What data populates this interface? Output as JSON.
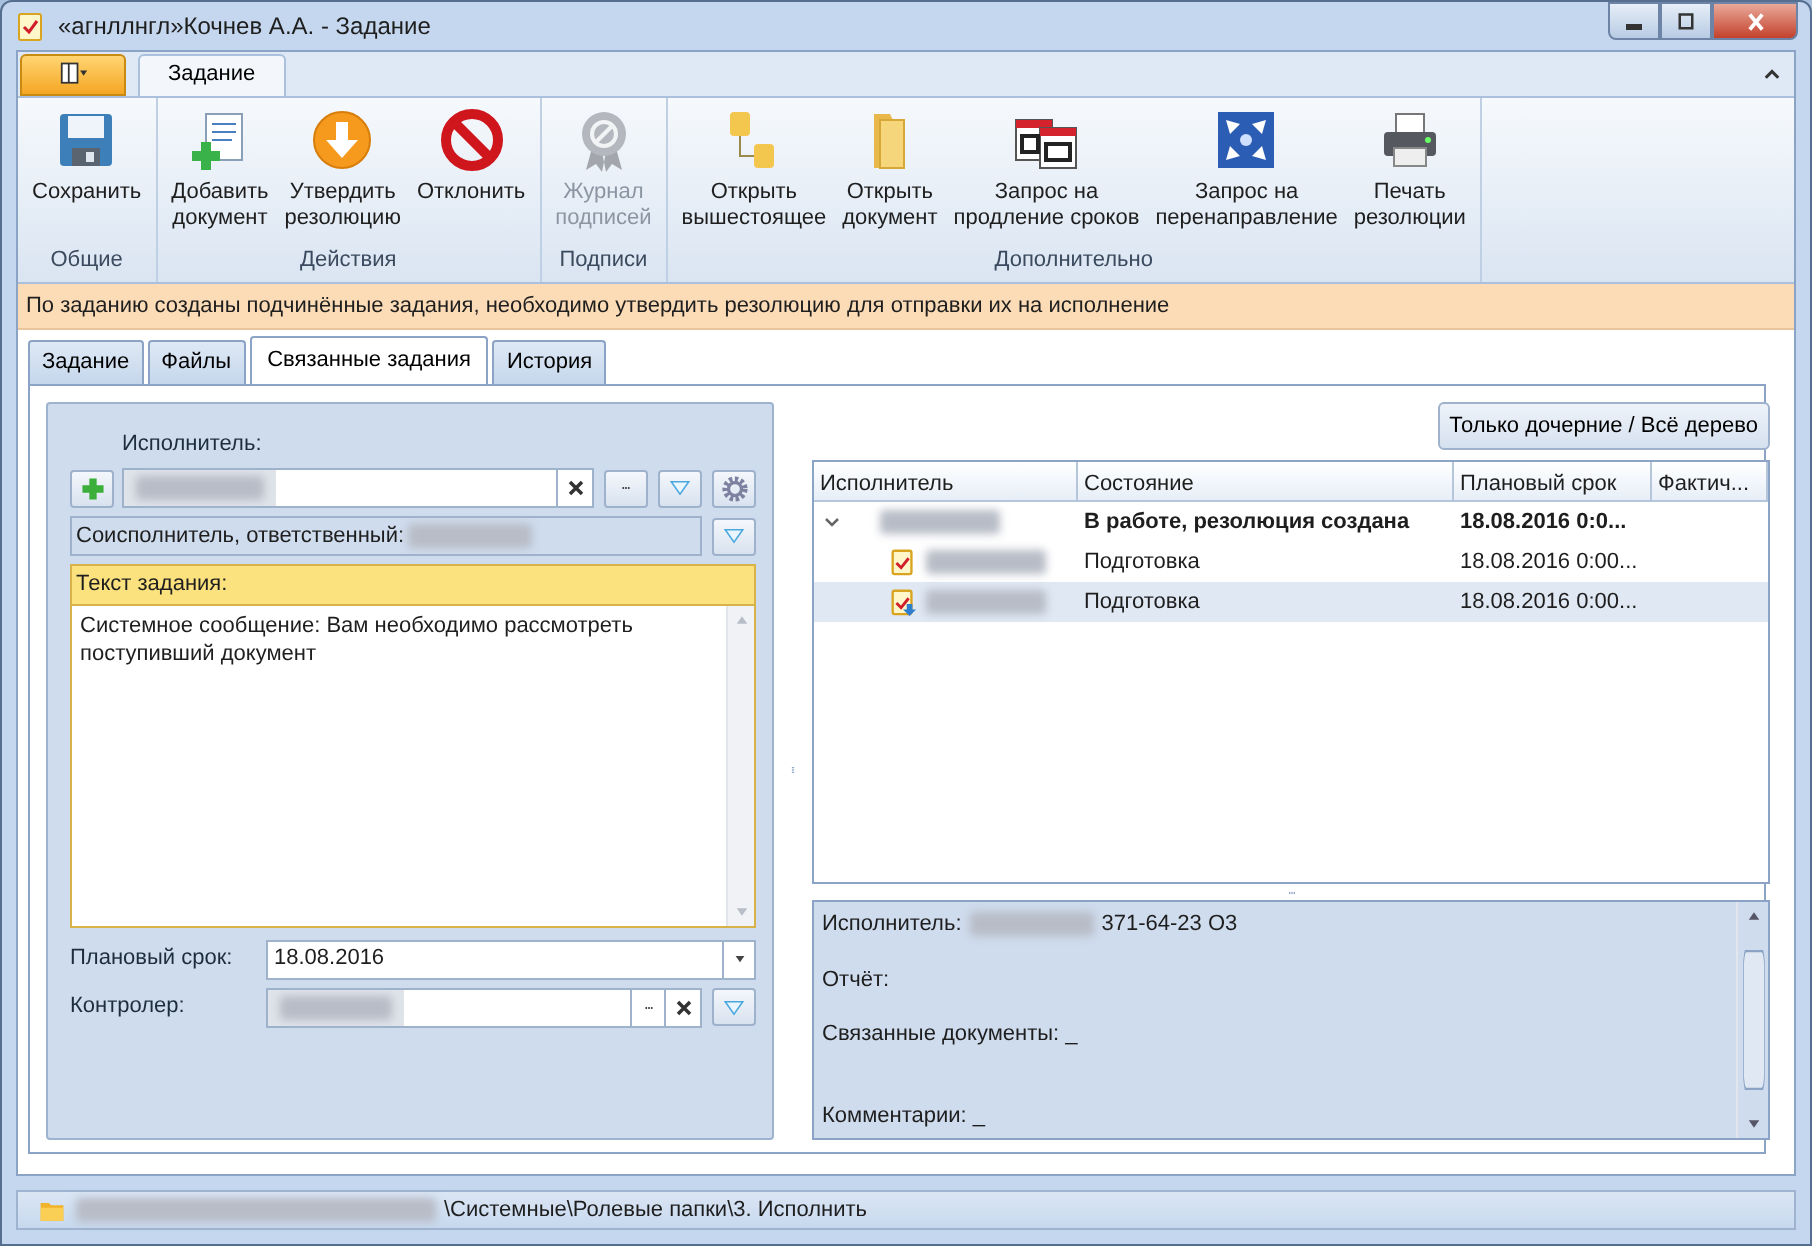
{
  "window": {
    "title": "«агнллнгл»Кочнев А.А. - Задание"
  },
  "ribbon": {
    "tabs": [
      {
        "label": "Задание",
        "selected": true
      }
    ],
    "groups": [
      {
        "label": "Общие",
        "buttons": [
          {
            "label": "Сохранить",
            "disabled": false
          }
        ]
      },
      {
        "label": "Действия",
        "buttons": [
          {
            "label": "Добавить документ",
            "disabled": false
          },
          {
            "label": "Утвердить резолюцию",
            "disabled": false
          },
          {
            "label": "Отклонить",
            "disabled": false
          }
        ]
      },
      {
        "label": "Подписи",
        "buttons": [
          {
            "label": "Журнал подписей",
            "disabled": true
          }
        ]
      },
      {
        "label": "Дополнительно",
        "buttons": [
          {
            "label": "Открыть вышестоящее",
            "disabled": false
          },
          {
            "label": "Открыть документ",
            "disabled": false
          },
          {
            "label": "Запрос на продление сроков",
            "disabled": false
          },
          {
            "label": "Запрос на перенаправление",
            "disabled": false
          },
          {
            "label": "Печать резолюции",
            "disabled": false
          }
        ]
      }
    ]
  },
  "info_bar": "По заданию созданы подчинённые задания, необходимо утвердить резолюцию для отправки их на исполнение",
  "tabs": [
    {
      "label": "Задание",
      "selected": false
    },
    {
      "label": "Файлы",
      "selected": false
    },
    {
      "label": "Связанные задания",
      "selected": true
    },
    {
      "label": "История",
      "selected": false
    }
  ],
  "form": {
    "executor_label": "Исполнитель:",
    "co_executor_label": "Соисполнитель, ответственный:",
    "task_text_label": "Текст задания:",
    "task_text": "Системное сообщение:  Вам необходимо рассмотреть поступивший документ",
    "due_label": "Плановый срок:",
    "due_value": "18.08.2016",
    "controller_label": "Контролер:"
  },
  "toggle_button": "Только дочерние / Всё дерево",
  "table": {
    "columns": [
      "Исполнитель",
      "Состояние",
      "Плановый срок",
      "Фактич..."
    ],
    "rows": [
      {
        "state": "В работе, резолюция создана",
        "due": "18.08.2016 0:0...",
        "expanded": true,
        "selected": false,
        "children": [
          {
            "kind": "task",
            "state": "Подготовка",
            "due": "18.08.2016 0:00...",
            "selected": false
          },
          {
            "kind": "sent",
            "state": "Подготовка",
            "due": "18.08.2016 0:00...",
            "selected": true
          }
        ]
      }
    ]
  },
  "details": {
    "executor_label": "Исполнитель:",
    "phone": "371-64-23 О3",
    "report": "Отчёт:",
    "documents": "Связанные документы: _",
    "comments": "Комментарии: _"
  },
  "status_bar": {
    "path": "\\Системные\\Ролевые папки\\3. Исполнить"
  }
}
